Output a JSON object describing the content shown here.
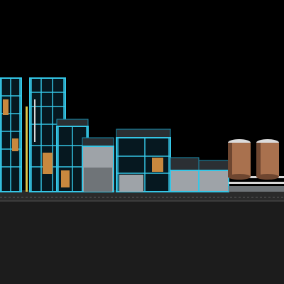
{
  "scene": {
    "subject": "industrial-plant-3d-model",
    "colors": {
      "sky": "#000000",
      "ground": "#1c1c1c",
      "ground_far": "#2a2a2a",
      "road_line": "#5b5b5b",
      "steel_cyan": "#35c6e6",
      "steel_deep": "#1a8fb0",
      "concrete": "#9ea3a8",
      "concrete_dark": "#6f7478",
      "roof": "#2b2f33",
      "pipe_yellow": "#d9c24a",
      "pipe_white": "#d8d8d8",
      "equipment_orange": "#c8883e",
      "tank_copper": "#a9714e",
      "tank_copper_dark": "#6e4630",
      "tank_top": "#dcdcdc"
    }
  }
}
